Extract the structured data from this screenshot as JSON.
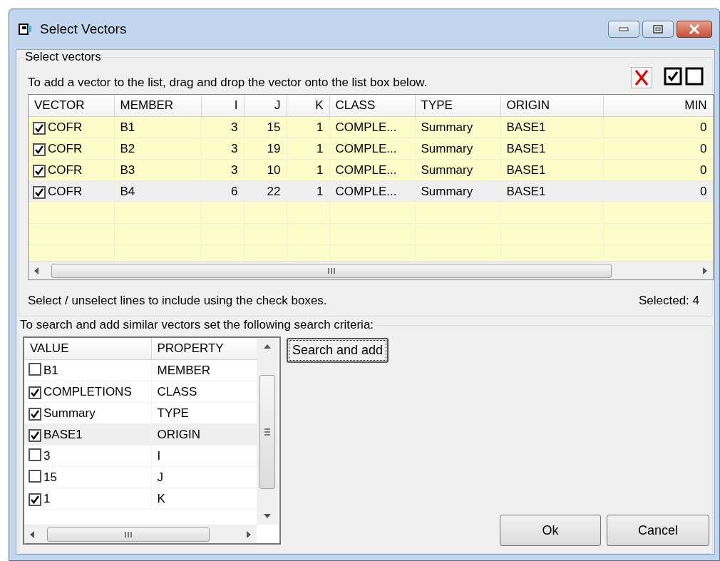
{
  "window": {
    "title": "Select Vectors"
  },
  "vector_group": {
    "label": "Select vectors",
    "instruction": "To add a vector to the list, drag and drop the vector onto the list box below.",
    "columns": [
      {
        "label": "VECTOR",
        "numeric": false
      },
      {
        "label": "MEMBER",
        "numeric": false
      },
      {
        "label": "I",
        "numeric": true
      },
      {
        "label": "J",
        "numeric": true
      },
      {
        "label": "K",
        "numeric": true
      },
      {
        "label": "CLASS",
        "numeric": false
      },
      {
        "label": "TYPE",
        "numeric": false
      },
      {
        "label": "ORIGIN",
        "numeric": false
      },
      {
        "label": "MIN",
        "numeric": true
      }
    ],
    "rows": [
      {
        "checked": true,
        "selected": false,
        "cells": [
          "COFR",
          "B1",
          "3",
          "15",
          "1",
          "COMPLE...",
          "Summary",
          "BASE1",
          "0"
        ]
      },
      {
        "checked": true,
        "selected": false,
        "cells": [
          "COFR",
          "B2",
          "3",
          "19",
          "1",
          "COMPLE...",
          "Summary",
          "BASE1",
          "0"
        ]
      },
      {
        "checked": true,
        "selected": false,
        "cells": [
          "COFR",
          "B3",
          "3",
          "10",
          "1",
          "COMPLE...",
          "Summary",
          "BASE1",
          "0"
        ]
      },
      {
        "checked": true,
        "selected": true,
        "cells": [
          "COFR",
          "B4",
          "6",
          "22",
          "1",
          "COMPLE...",
          "Summary",
          "BASE1",
          "0"
        ]
      }
    ],
    "hint": "Select / unselect lines to include using the check boxes.",
    "selected_count": "Selected: 4"
  },
  "search_group": {
    "label": "To search and add similar vectors set the following search criteria:",
    "columns": [
      "VALUE",
      "PROPERTY"
    ],
    "items": [
      {
        "value": "B1",
        "property": "MEMBER",
        "checked": false,
        "selected": false
      },
      {
        "value": "COMPLETIONS",
        "property": "CLASS",
        "checked": true,
        "selected": false
      },
      {
        "value": "Summary",
        "property": "TYPE",
        "checked": true,
        "selected": false
      },
      {
        "value": "BASE1",
        "property": "ORIGIN",
        "checked": true,
        "selected": true
      },
      {
        "value": "3",
        "property": "I",
        "checked": false,
        "selected": false
      },
      {
        "value": "15",
        "property": "J",
        "checked": false,
        "selected": false
      },
      {
        "value": "1",
        "property": "K",
        "checked": true,
        "selected": false
      }
    ],
    "search_button": "Search and add"
  },
  "buttons": [
    "Ok",
    "Cancel"
  ]
}
